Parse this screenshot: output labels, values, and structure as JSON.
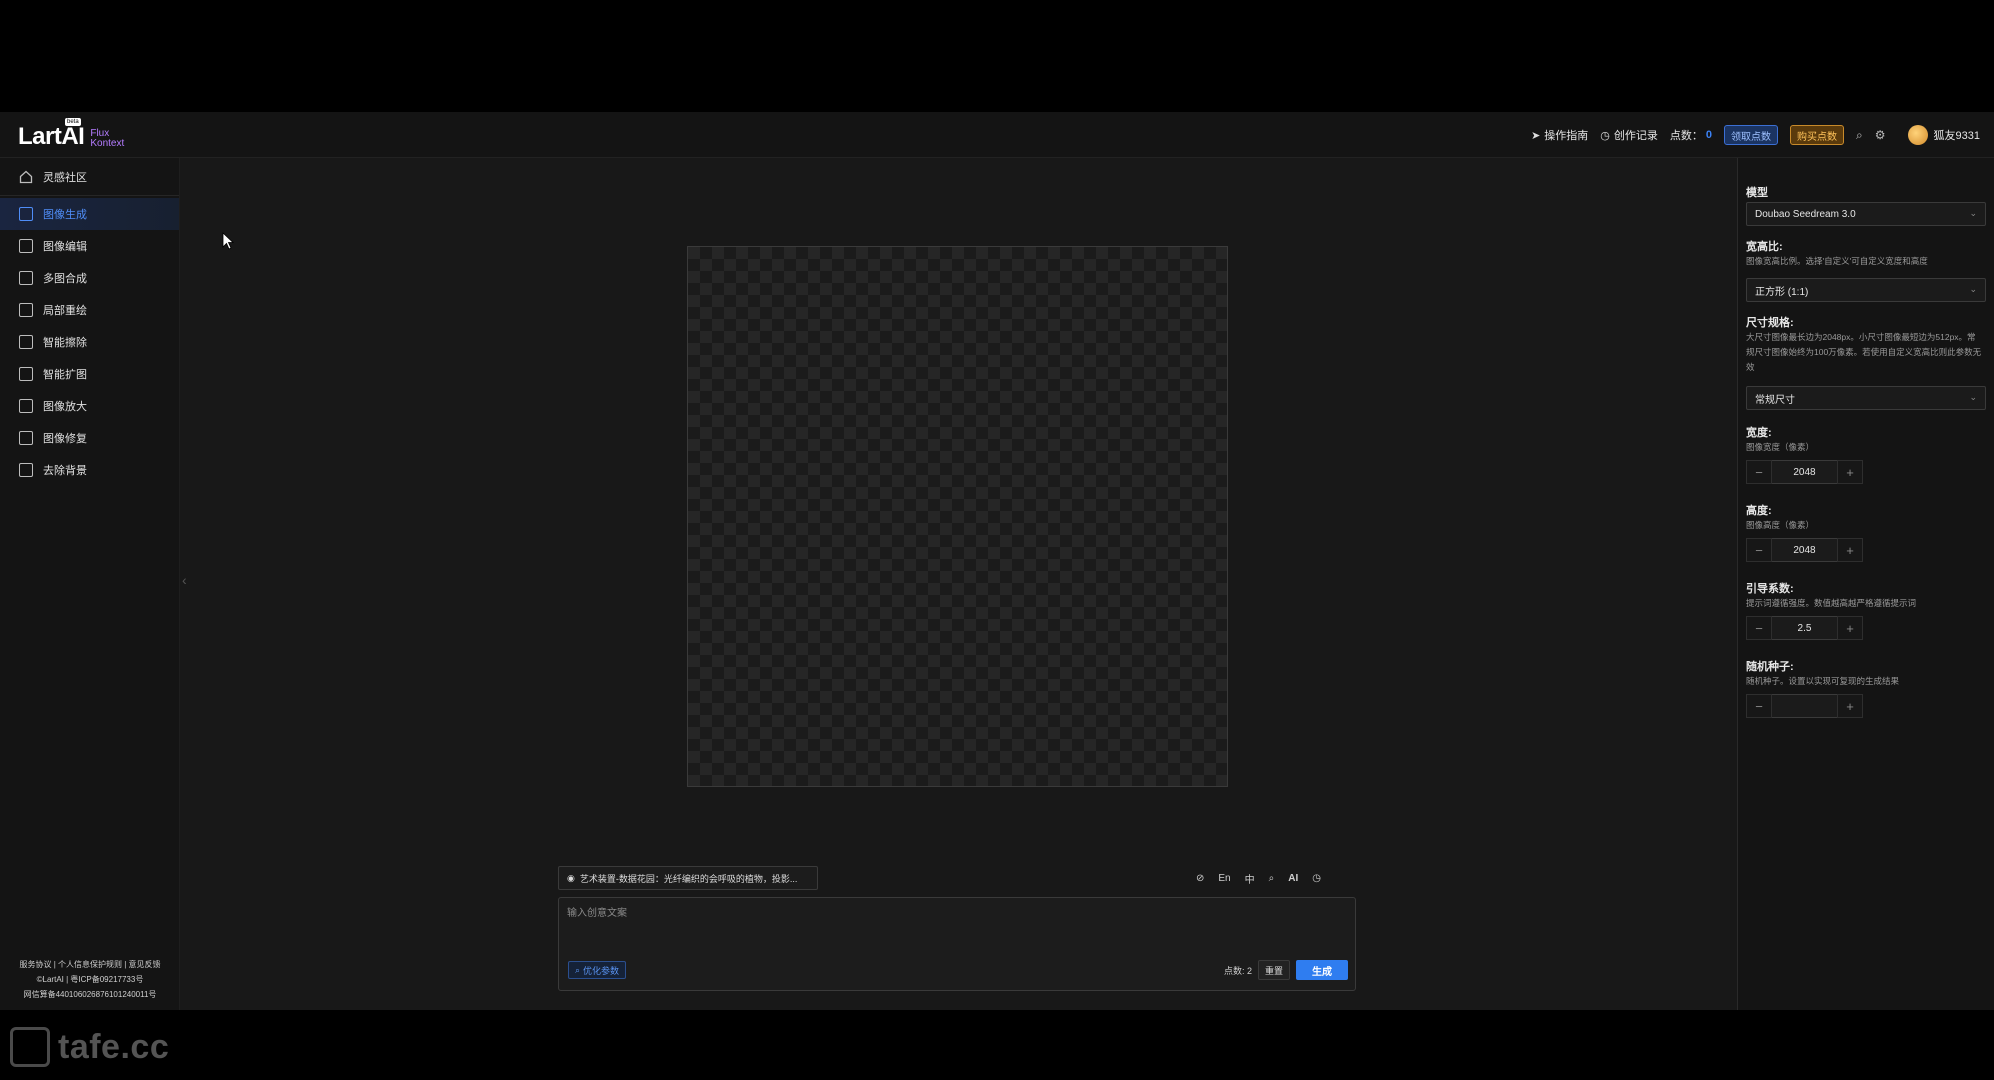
{
  "header": {
    "logo_main": "LartAI",
    "logo_beta": "beta",
    "logo_sub_1": "Flux",
    "logo_sub_2": "Kontext",
    "guide_label": "操作指南",
    "history_label": "创作记录",
    "points_label": "点数：",
    "points_value": "0",
    "claim_label": "领取点数",
    "buy_label": "购买点数",
    "username": "狐友9331"
  },
  "sidebar": {
    "items": [
      {
        "label": "灵感社区",
        "icon": "home-icon"
      },
      {
        "label": "图像生成",
        "icon": "chat-image-icon"
      },
      {
        "label": "图像编辑",
        "icon": "image-edit-icon"
      },
      {
        "label": "多图合成",
        "icon": "multi-image-icon"
      },
      {
        "label": "局部重绘",
        "icon": "brush-icon"
      },
      {
        "label": "智能擦除",
        "icon": "eraser-icon"
      },
      {
        "label": "智能扩图",
        "icon": "crop-expand-icon"
      },
      {
        "label": "图像放大",
        "icon": "upscale-icon"
      },
      {
        "label": "图像修复",
        "icon": "repair-icon"
      },
      {
        "label": "去除背景",
        "icon": "remove-bg-icon"
      }
    ],
    "active_index": 1,
    "footer_line1": "服务协议 | 个人信息保护规则 | 意见反馈",
    "footer_line2": "©LartAI | 粤ICP备09217733号",
    "footer_line3": "网信算备440106026876101240011号"
  },
  "prompt": {
    "preset_text": "艺术装置-数据花园：光纤编织的会呼吸的植物，投影...",
    "tools": [
      "En",
      "中",
      "AI"
    ],
    "placeholder": "输入创意文案",
    "optimize_label": "优化参数",
    "cost_label": "点数: 2",
    "reset_label": "重置",
    "generate_label": "生成"
  },
  "settings": {
    "model_label": "模型",
    "model_value": "Doubao Seedream 3.0",
    "ratio_label": "宽高比:",
    "ratio_desc": "图像宽高比例。选择'自定义'可自定义宽度和高度",
    "ratio_value": "正方形 (1:1)",
    "size_label": "尺寸规格:",
    "size_desc": "大尺寸图像最长边为2048px。小尺寸图像最短边为512px。常规尺寸图像始终为100万像素。若使用自定义宽高比则此参数无效",
    "size_value": "常规尺寸",
    "width_label": "宽度:",
    "width_desc": "图像宽度（像素）",
    "width_value": "2048",
    "height_label": "高度:",
    "height_desc": "图像高度（像素）",
    "height_value": "2048",
    "guidance_label": "引导系数:",
    "guidance_desc": "提示词遵循强度。数值越高越严格遵循提示词",
    "guidance_value": "2.5",
    "seed_label": "随机种子:",
    "seed_desc": "随机种子。设置以实现可复现的生成结果",
    "seed_value": ""
  },
  "watermark": "tafe.cc"
}
